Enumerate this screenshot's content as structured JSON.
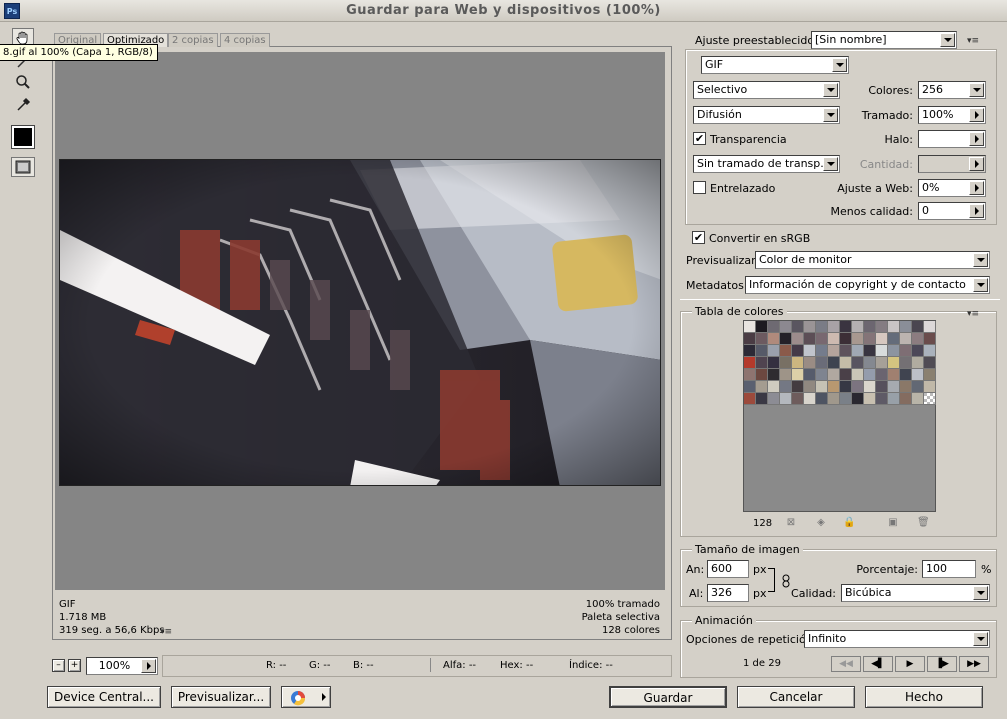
{
  "window": {
    "title": "Guardar para Web y dispositivos (100%)",
    "app_icon": "Ps"
  },
  "tools": {
    "items": [
      "hand-icon",
      "slice-select-icon",
      "zoom-icon",
      "eyedropper-icon",
      "color-swatch",
      "toggle-slices-icon"
    ],
    "swatch_color": "#000000"
  },
  "tabs": [
    {
      "label": "Original",
      "active": false
    },
    {
      "label": "Optimizado",
      "active": true
    },
    {
      "label": "2 copias",
      "active": false
    },
    {
      "label": "4 copias",
      "active": false
    }
  ],
  "tooltip": "8.gif al 100% (Capa 1, RGB/8)",
  "preview_info": {
    "format": "GIF",
    "size": "1.718 MB",
    "time": "319 seg. a 56,6 Kbps",
    "dither": "100% tramado",
    "palette": "Paleta selectiva",
    "colors": "128 colores"
  },
  "zoom": {
    "minus": "–",
    "plus": "+",
    "value": "100%"
  },
  "status": {
    "r": "R: --",
    "g": "G: --",
    "b": "B: --",
    "alfa": "Alfa: --",
    "hex": "Hex: --",
    "indice": "Índice: --"
  },
  "bottom_buttons": {
    "device_central": "Device Central...",
    "previsualizar": "Previsualizar...",
    "guardar": "Guardar",
    "cancelar": "Cancelar",
    "hecho": "Hecho"
  },
  "settings": {
    "preset_label": "Ajuste preestablecido:",
    "preset_value": "[Sin nombre]",
    "format": "GIF",
    "reduction": "Selectivo",
    "dither_algo": "Difusión",
    "transparency_label": "Transparencia",
    "transparency_checked": true,
    "transparency_dither": "Sin tramado de transp...",
    "interlaced_label": "Entrelazado",
    "interlaced_checked": false,
    "colores_label": "Colores:",
    "colores_value": "256",
    "tramado_label": "Tramado:",
    "tramado_value": "100%",
    "halo_label": "Halo:",
    "halo_value": "",
    "cantidad_label": "Cantidad:",
    "cantidad_value": "",
    "ajuste_web_label": "Ajuste a Web:",
    "ajuste_web_value": "0%",
    "menos_calidad_label": "Menos calidad:",
    "menos_calidad_value": "0",
    "srgb_label": "Convertir en sRGB",
    "srgb_checked": true,
    "previsualizar_label": "Previsualizar:",
    "previsualizar_value": "Color de monitor",
    "metadatos_label": "Metadatos:",
    "metadatos_value": "Información de copyright y de contacto",
    "checkmark": "✔"
  },
  "color_table": {
    "title": "Tabla de colores",
    "count": "128",
    "colors": [
      "#e8e4e0",
      "#1c1a20",
      "#6e6a72",
      "#8c8890",
      "#5a5660",
      "#9a9496",
      "#7a7c86",
      "#a8a2a6",
      "#3a3440",
      "#b4b0b2",
      "#6c6670",
      "#847c82",
      "#c8c4c4",
      "#8a8e98",
      "#4a4650",
      "#dcd8d8",
      "#4a3c44",
      "#6c5a60",
      "#b08a7c",
      "#242028",
      "#9c8c8c",
      "#5c4e56",
      "#786870",
      "#cdbab0",
      "#3c2e36",
      "#a89890",
      "#847478",
      "#d6c8c0",
      "#646c7a",
      "#bcb4b0",
      "#8c7c80",
      "#6a4c4c",
      "#2c2a36",
      "#565a68",
      "#9aa0ac",
      "#8a5a4a",
      "#443a48",
      "#c0c4cc",
      "#747c8c",
      "#b4a49c",
      "#5e525c",
      "#a0a8b4",
      "#383440",
      "#d8dcdc",
      "#8c94a0",
      "#7e6e74",
      "#4c4858",
      "#aab2bc",
      "#b43a2c",
      "#504450",
      "#343040",
      "#787064",
      "#ccb680",
      "#9a8c84",
      "#6a6c78",
      "#3e4450",
      "#c4bca8",
      "#585460",
      "#848890",
      "#a6a098",
      "#d4c480",
      "#747074",
      "#b0aca0",
      "#504c54",
      "#8e7470",
      "#6c4840",
      "#2e2c30",
      "#9e9488",
      "#dcd0a8",
      "#565c6c",
      "#7e8490",
      "#b0a8a0",
      "#4a4048",
      "#cac6b8",
      "#949cac",
      "#6a6470",
      "#a08070",
      "#404450",
      "#bcc0c8",
      "#8a8070",
      "#5a6070",
      "#a49c90",
      "#d0ccc0",
      "#747884",
      "#443c40",
      "#908880",
      "#c6c2b4",
      "#b89870",
      "#363844",
      "#7c7480",
      "#dad6cc",
      "#56505c",
      "#a6aab0",
      "#8a7868",
      "#626874",
      "#c0b8a8",
      "#9c4a3c",
      "#3a3844",
      "#8c8c94",
      "#b4b8be",
      "#6e5c5c",
      "#d8d4cc",
      "#4e5462",
      "#a0988c",
      "#7a8088",
      "#2a2830",
      "#c8c0b0",
      "#5e5a66",
      "#98a0a8",
      "#846c60",
      "#b8b4a8",
      "transparent"
    ]
  },
  "image_size": {
    "title": "Tamaño de imagen",
    "an_label": "An:",
    "an_value": "600",
    "al_label": "Al:",
    "al_value": "326",
    "unit": "px",
    "porcentaje_label": "Porcentaje:",
    "porcentaje_value": "100",
    "porcentaje_unit": "%",
    "calidad_label": "Calidad:",
    "calidad_value": "Bicúbica"
  },
  "animation": {
    "title": "Animación",
    "repeat_label": "Opciones de repetición:",
    "repeat_value": "Infinito",
    "frame": "1 de 29",
    "controls": [
      "first-frame-icon",
      "prev-frame-icon",
      "play-icon",
      "next-frame-icon",
      "last-frame-icon"
    ]
  }
}
